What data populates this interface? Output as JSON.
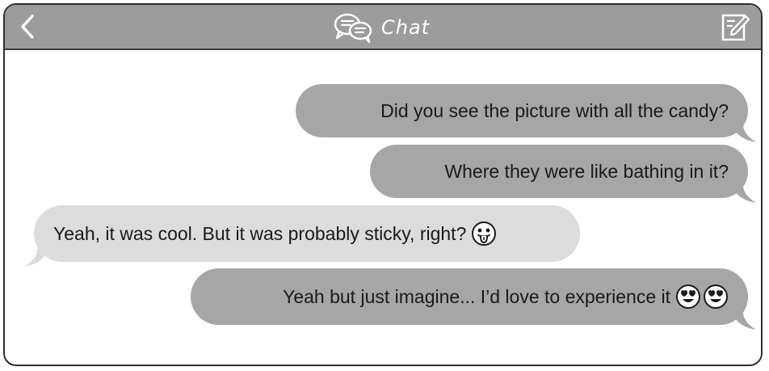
{
  "header": {
    "title": "Chat",
    "back_icon": "chevron-left-icon",
    "chat_icon": "chat-bubbles-icon",
    "compose_icon": "compose-icon"
  },
  "colors": {
    "header_bg": "#9c9c9c",
    "outgoing_bubble": "#a6a6a6",
    "incoming_bubble": "#dcdcdc",
    "border": "#2e2e2e"
  },
  "messages": [
    {
      "direction": "outgoing",
      "text": "Did you see the picture with all the candy?",
      "emojis": []
    },
    {
      "direction": "outgoing",
      "text": "Where they were like bathing in it?",
      "emojis": []
    },
    {
      "direction": "incoming",
      "text": "Yeah, it was cool. But it was probably sticky, right?",
      "emojis": [
        "tongue-out-emoji"
      ]
    },
    {
      "direction": "outgoing",
      "text": "Yeah but just imagine... I’d love to experience it",
      "emojis": [
        "heart-eyes-emoji",
        "heart-eyes-emoji"
      ]
    }
  ]
}
